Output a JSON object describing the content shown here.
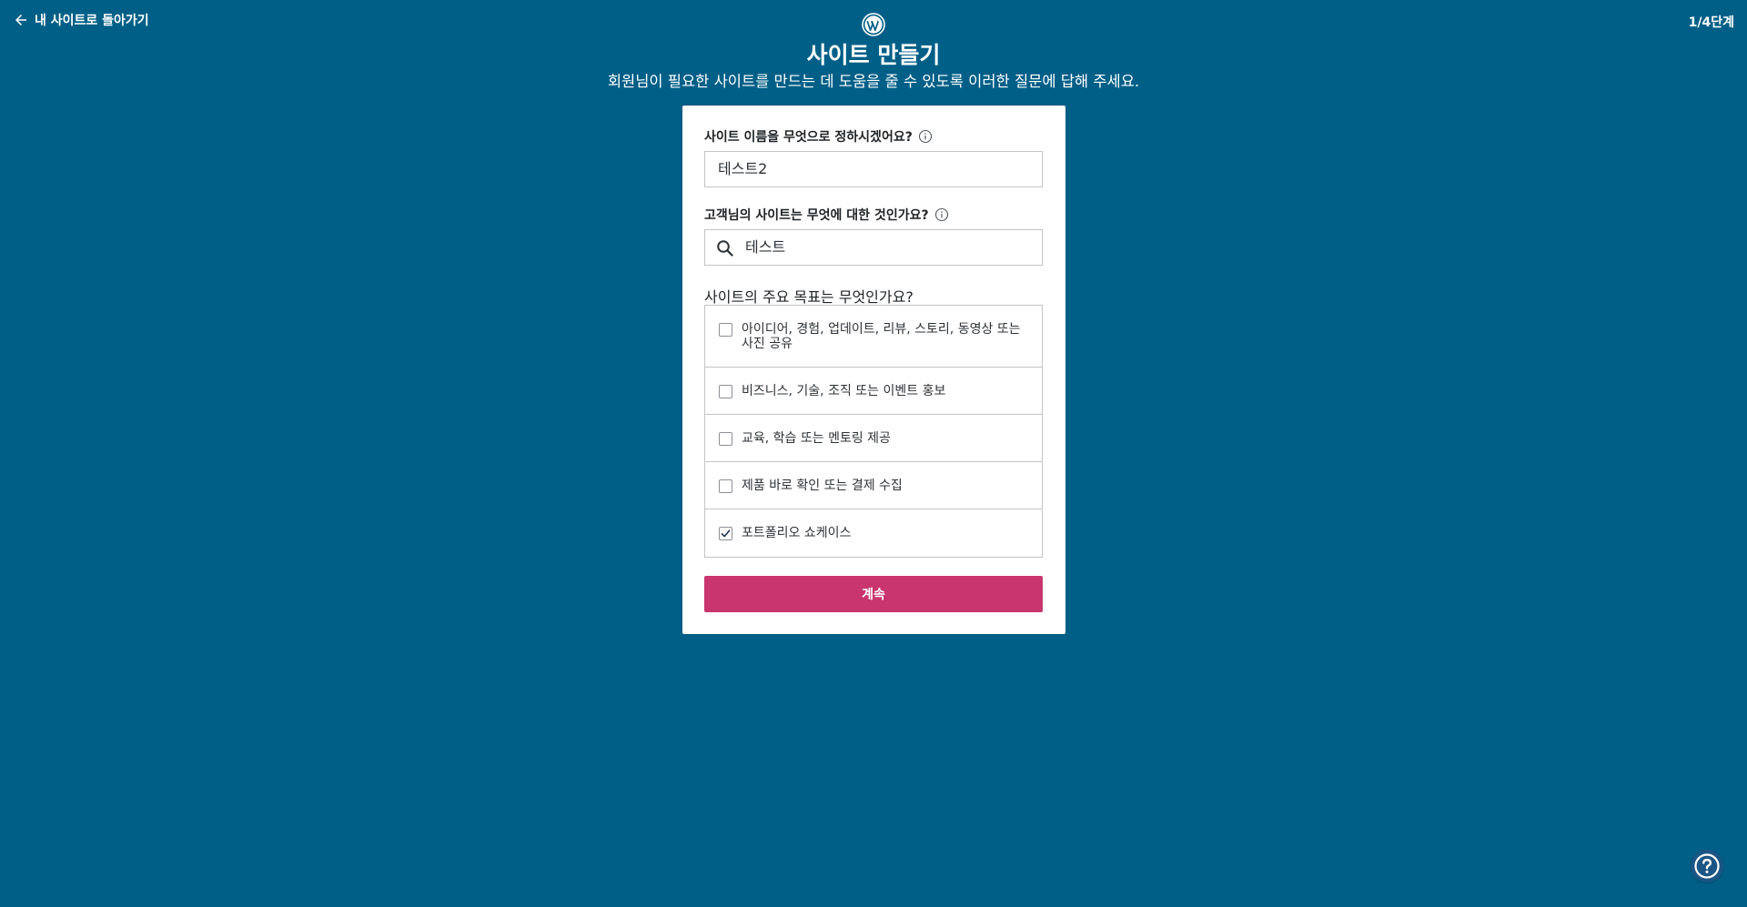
{
  "topbar": {
    "back_label": "내 사이트로 돌아가기",
    "step_label": "1/4단계"
  },
  "header": {
    "title": "사이트 만들기",
    "subtitle": "회원님이 필요한 사이트를 만드는 데 도움을 줄 수 있도록 이러한 질문에 답해 주세요."
  },
  "form": {
    "site_name": {
      "label": "사이트 이름을 무엇으로 정하시겠어요?",
      "value": "테스트2"
    },
    "site_topic": {
      "label": "고객님의 사이트는 무엇에 대한 것인가요?",
      "value": "테스트"
    },
    "goals": {
      "label": "사이트의 주요 목표는 무엇인가요?",
      "items": [
        {
          "label": "아이디어, 경험, 업데이트, 리뷰, 스토리, 동영상 또는 사진 공유",
          "checked": false
        },
        {
          "label": "비즈니스, 기술, 조직 또는 이벤트 홍보",
          "checked": false
        },
        {
          "label": "교육, 학습 또는 멘토링 제공",
          "checked": false
        },
        {
          "label": "제품 바로 확인 또는 결제 수집",
          "checked": false
        },
        {
          "label": "포트폴리오 쇼케이스",
          "checked": true
        }
      ]
    },
    "continue_label": "계속"
  },
  "icons": {
    "back": "arrow-left-icon",
    "logo": "wordpress-logo-icon",
    "info": "info-icon",
    "search": "search-icon",
    "check": "checkmark-icon",
    "help": "help-question-icon"
  },
  "colors": {
    "background": "#005f87",
    "primary_button": "#c9356e",
    "help_button": "#1b5585"
  }
}
